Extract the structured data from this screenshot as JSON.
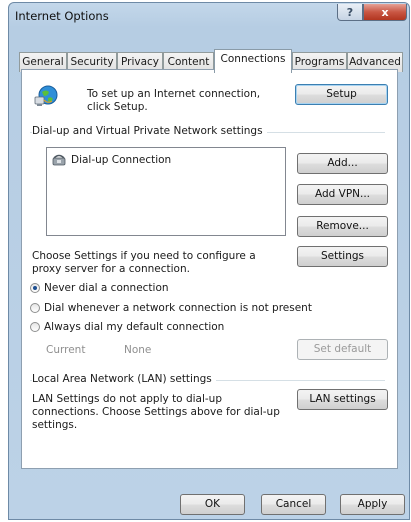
{
  "window": {
    "title": "Internet Options"
  },
  "titlebar": {
    "help_glyph": "?",
    "close_glyph": "x"
  },
  "tabs": [
    {
      "label": "General"
    },
    {
      "label": "Security"
    },
    {
      "label": "Privacy"
    },
    {
      "label": "Content"
    },
    {
      "label": "Connections"
    },
    {
      "label": "Programs"
    },
    {
      "label": "Advanced"
    }
  ],
  "active_tab": "Connections",
  "setup": {
    "text": "To set up an Internet connection, click Setup.",
    "button": "Setup",
    "icon": "globe-connection-icon"
  },
  "dialup": {
    "group_label": "Dial-up and Virtual Private Network settings",
    "items": [
      {
        "label": "Dial-up Connection",
        "icon": "dialup-phone-icon"
      }
    ],
    "buttons": {
      "add": "Add...",
      "add_vpn": "Add VPN...",
      "remove": "Remove...",
      "settings": "Settings"
    },
    "proxy_text": "Choose Settings if you need to configure a proxy server for a connection.",
    "options": [
      {
        "label": "Never dial a connection",
        "checked": true
      },
      {
        "label": "Dial whenever a network connection is not present",
        "checked": false
      },
      {
        "label": "Always dial my default connection",
        "checked": false
      }
    ],
    "current_label": "Current",
    "current_value": "None",
    "set_default": "Set default"
  },
  "lan": {
    "group_label": "Local Area Network (LAN) settings",
    "text": "LAN Settings do not apply to dial-up connections. Choose Settings above for dial-up settings.",
    "button": "LAN settings"
  },
  "footer": {
    "ok": "OK",
    "cancel": "Cancel",
    "apply": "Apply"
  },
  "colors": {
    "window_frame": "#b9d1ea",
    "close_red": "#c45843",
    "radio_dot": "#1d4f91"
  }
}
